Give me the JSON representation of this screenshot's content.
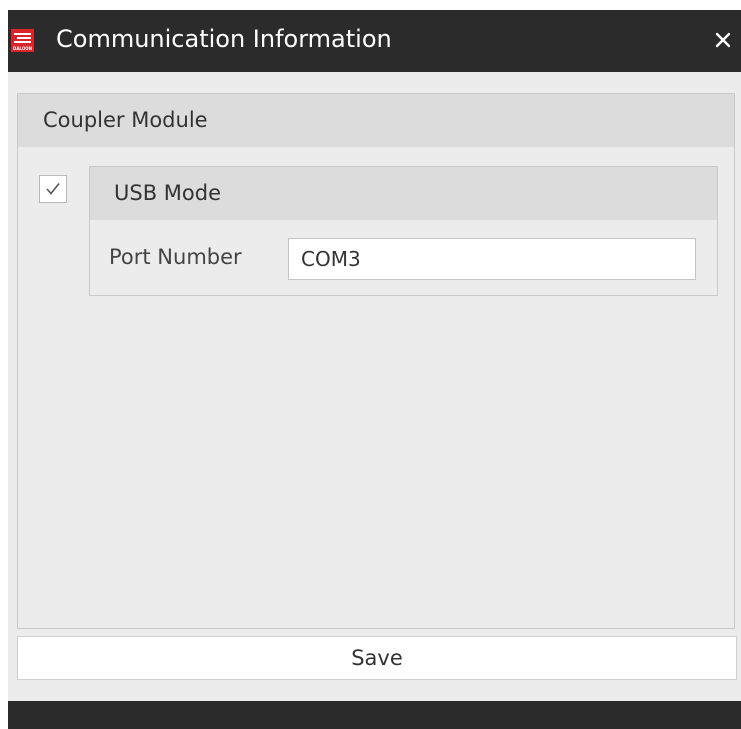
{
  "window": {
    "title": "Communication Information",
    "logo_text": "DALOON",
    "logo_icon": "daloon-logo-icon",
    "close_icon": "close-icon"
  },
  "coupler_group": {
    "header": "Coupler Module",
    "usb_mode_checked": true,
    "usb_mode": {
      "header": "USB Mode",
      "port_label": "Port Number",
      "port_value": "COM3"
    }
  },
  "footer": {
    "save_label": "Save"
  },
  "colors": {
    "titlebar": "#2b2b2b",
    "brand_red": "#d9252a",
    "panel": "#ececec",
    "header": "#dcdcdc"
  }
}
